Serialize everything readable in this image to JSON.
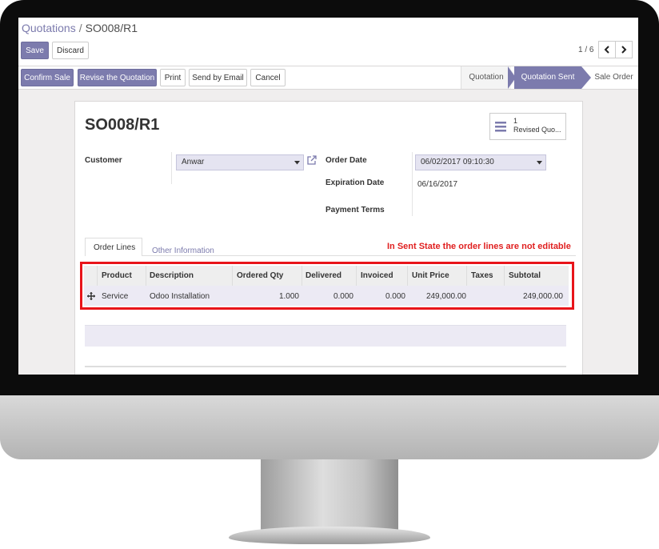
{
  "breadcrumb": {
    "parent": "Quotations",
    "separator": "/",
    "current": "SO008/R1"
  },
  "buttons": {
    "save": "Save",
    "discard": "Discard"
  },
  "pager": {
    "text": "1 / 6",
    "prev": "‹",
    "next": "›"
  },
  "actions": {
    "confirm": "Confirm Sale",
    "revise": "Revise the Quotation",
    "print": "Print",
    "email": "Send by Email",
    "cancel": "Cancel"
  },
  "stages": [
    {
      "label": "Quotation"
    },
    {
      "label": "Quotation Sent",
      "active": true
    },
    {
      "label": "Sale Order"
    }
  ],
  "record": {
    "title": "SO008/R1",
    "smart_button": {
      "count": "1",
      "label": "Revised Quo..."
    },
    "customer_label": "Customer",
    "customer_value": "Anwar",
    "order_date_label": "Order Date",
    "order_date_value": "06/02/2017 09:10:30",
    "expiration_label": "Expiration Date",
    "expiration_value": "06/16/2017",
    "payment_terms_label": "Payment Terms"
  },
  "tabs": [
    "Order Lines",
    "Other Information"
  ],
  "annotation": "In Sent State the order lines are not editable",
  "table": {
    "columns": [
      "Product",
      "Description",
      "Ordered Qty",
      "Delivered",
      "Invoiced",
      "Unit Price",
      "Taxes",
      "Subtotal"
    ],
    "rows": [
      {
        "product": "Service",
        "description": "Odoo Installation",
        "ordered": "1.000",
        "delivered": "0.000",
        "invoiced": "0.000",
        "unit_price": "249,000.00",
        "taxes": "",
        "subtotal": "249,000.00"
      }
    ]
  },
  "colors": {
    "primary": "#7c7bad",
    "active_stage": "#7c7bad",
    "annotation": "#e02020",
    "highlight_border": "#e8141a"
  },
  "icons": {
    "external_link": "external-link-icon",
    "hamburger": "hamburger-icon",
    "drag": "drag-handle-icon"
  }
}
